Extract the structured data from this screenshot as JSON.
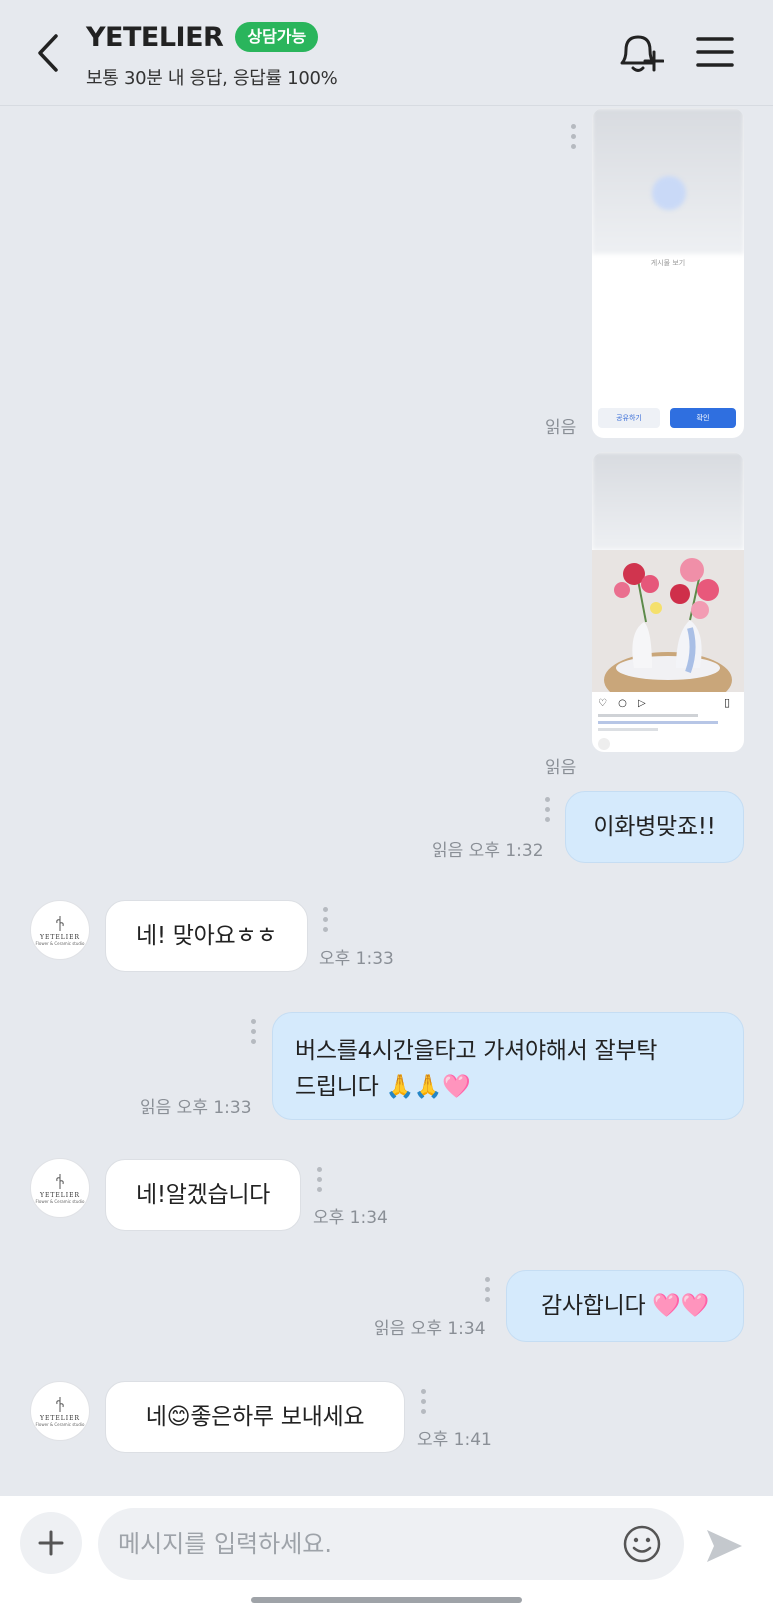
{
  "header": {
    "title": "YETELIER",
    "badge": "상담가능",
    "subtitle": "보통 30분 내 응답, 응답률 100%"
  },
  "messages": {
    "img1": {
      "meta": "읽음",
      "btn_left": "공유하기",
      "btn_right": "확인",
      "inner_text": "게시물 보기"
    },
    "img2": {
      "meta": "읽음"
    },
    "m1": {
      "text": "이화병맞죠!!",
      "meta": "읽음 오후 1:32"
    },
    "m2": {
      "text": "네! 맞아요ㅎㅎ",
      "meta": "오후 1:33"
    },
    "m3": {
      "line1": "버스를4시간을타고 가셔야해서 잘부탁",
      "line2": "드립니다 🙏🙏🩷",
      "meta": "읽음 오후 1:33"
    },
    "m4": {
      "text": "네!알겠습니다",
      "meta": "오후 1:34"
    },
    "m5": {
      "text": "감사합니다 🩷🩷",
      "meta": "읽음 오후 1:34"
    },
    "m6": {
      "text": "네😊좋은하루 보내세요",
      "meta": "오후 1:41"
    }
  },
  "avatar": {
    "name": "YETELIER",
    "tagline": "Flower & Ceramic studio"
  },
  "input": {
    "placeholder": "메시지를 입력하세요."
  },
  "colors": {
    "accent_green": "#2ab55c",
    "outgoing_bubble": "#d5eafc",
    "background": "#e6e9ee"
  }
}
